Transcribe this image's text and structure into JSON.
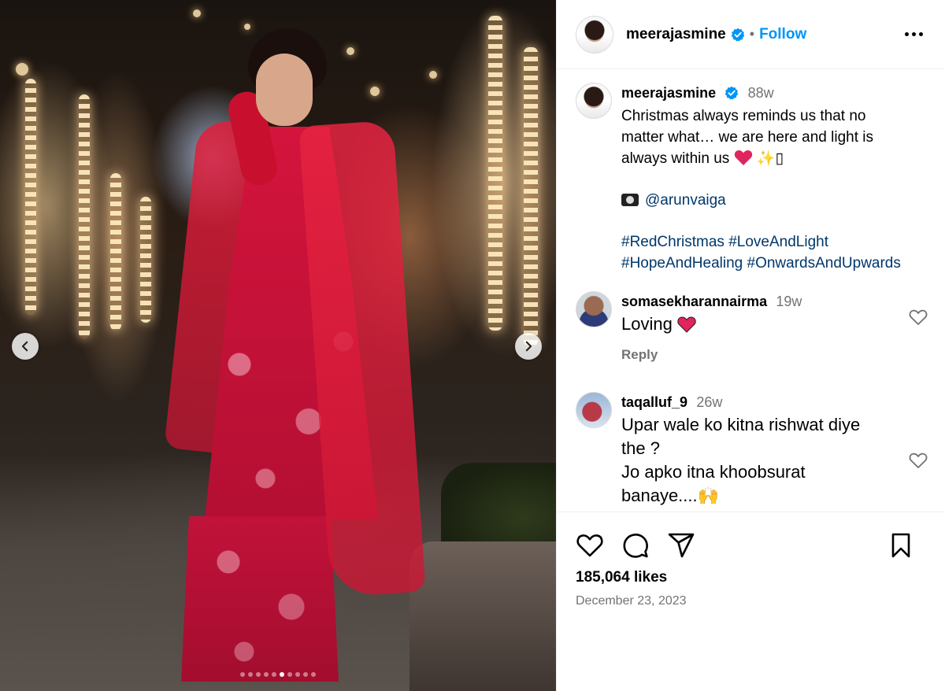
{
  "header": {
    "username": "meerajasmine",
    "separator": "•",
    "follow_label": "Follow"
  },
  "caption": {
    "username": "meerajasmine",
    "time": "88w",
    "line1": "Christmas always reminds us that no",
    "line2": "matter what… we are here and light is",
    "line3": "always within us",
    "sparkle": "✨",
    "trailing": "▯",
    "mention": "@arunvaiga",
    "hashtags_line1": "#RedChristmas #LoveAndLight",
    "hashtags_line2": "#HopeAndHealing #OnwardsAndUpwards"
  },
  "comments": [
    {
      "username": "somasekharannairma",
      "time": "19w",
      "text": "Loving",
      "reply_label": "Reply"
    },
    {
      "username": "taqalluf_9",
      "time": "26w",
      "line1": "Upar wale ko kitna rishwat diye",
      "line2": "the ?",
      "line3": "Jo apko itna khoobsurat",
      "line4": "banaye....",
      "emoji": "🙌"
    }
  ],
  "stats": {
    "likes": "185,064 likes",
    "date": "December 23, 2023"
  },
  "carousel": {
    "total_slides": 10,
    "active_slide": 6
  },
  "colors": {
    "accent": "#0095f6",
    "verified": "#0095f6",
    "heart": "#e0245e"
  },
  "icons": [
    "chevron-left-icon",
    "chevron-right-icon",
    "verified-badge-icon",
    "more-icon",
    "heart-icon",
    "comment-icon",
    "share-icon",
    "bookmark-icon",
    "camera-icon"
  ]
}
